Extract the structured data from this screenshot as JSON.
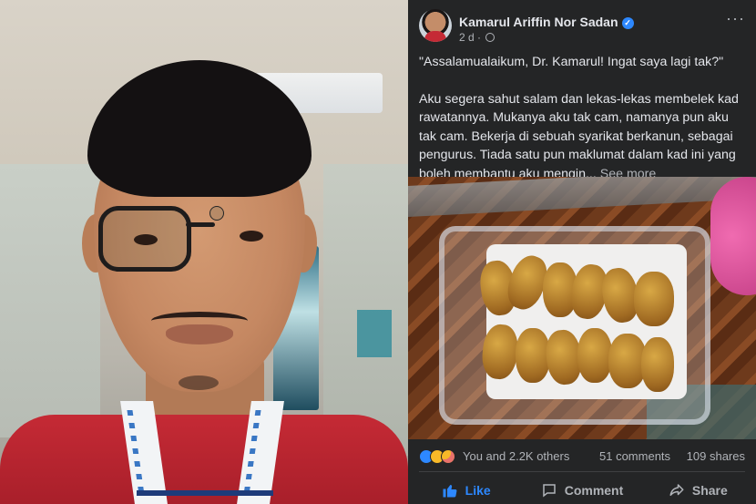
{
  "post": {
    "author": "Kamarul Ariffin Nor Sadan",
    "time": "2 d ·",
    "more": "···",
    "paragraph1": "\"Assalamualaikum, Dr. Kamarul! Ingat saya lagi tak?\"",
    "paragraph2": "Aku segera sahut salam dan lekas-lekas membelek kad rawatannya. Mukanya aku tak cam, namanya pun aku tak cam. Bekerja di sebuah syarikat berkanun, sebagai pengurus. Tiada satu pun maklumat dalam kad ini yang boleh membantu aku mengin...",
    "see_more": "See more"
  },
  "stats": {
    "reactions_text": "You and 2.2K others",
    "comments": "51 comments",
    "shares": "109 shares"
  },
  "actions": {
    "like": "Like",
    "comment": "Comment",
    "share": "Share"
  },
  "colors": {
    "accent": "#2d88ff",
    "panel_bg": "#242526",
    "text_primary": "#e4e6eb",
    "text_secondary": "#b0b3b8"
  },
  "icons": [
    "verified-badge-icon",
    "globe-icon",
    "more-options-icon",
    "like-reaction-icon",
    "sad-reaction-icon",
    "care-reaction-icon",
    "thumbs-up-icon",
    "comment-icon",
    "share-icon"
  ]
}
